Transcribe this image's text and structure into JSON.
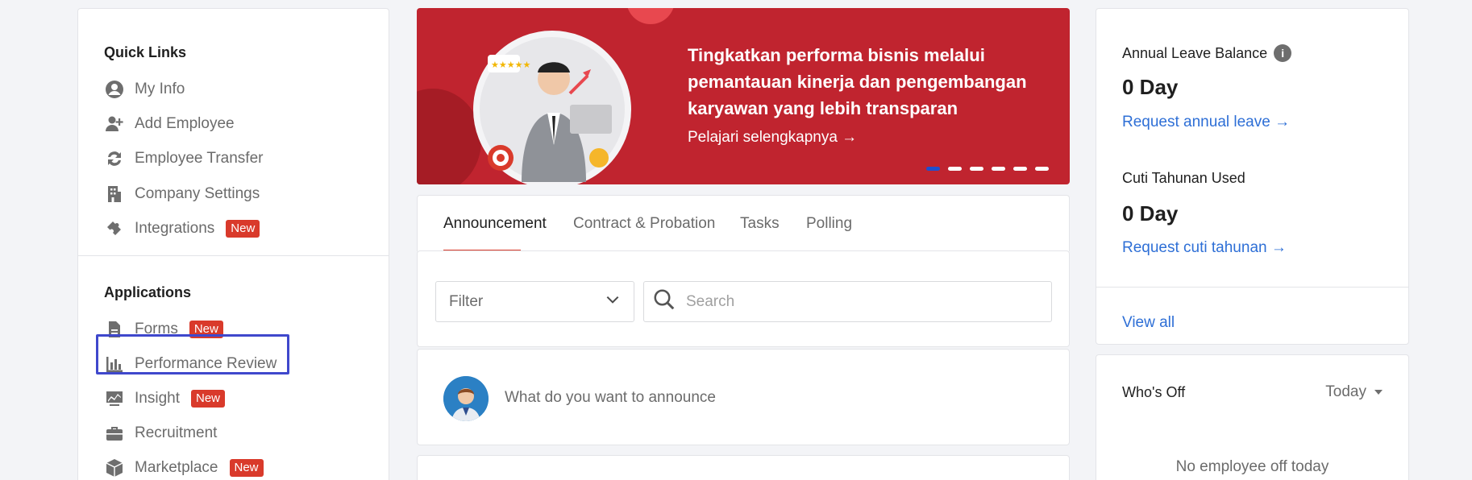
{
  "quick_links": {
    "title": "Quick Links",
    "items": [
      {
        "label": "My Info",
        "icon": "user-circle-icon",
        "badge": ""
      },
      {
        "label": "Add Employee",
        "icon": "user-plus-icon",
        "badge": ""
      },
      {
        "label": "Employee Transfer",
        "icon": "transfer-arrows-icon",
        "badge": ""
      },
      {
        "label": "Company Settings",
        "icon": "building-icon",
        "badge": ""
      },
      {
        "label": "Integrations",
        "icon": "puzzle-icon",
        "badge": "New"
      }
    ]
  },
  "applications": {
    "title": "Applications",
    "items": [
      {
        "label": "Forms",
        "icon": "document-icon",
        "badge": "New"
      },
      {
        "label": "Performance Review",
        "icon": "bar-chart-icon",
        "badge": ""
      },
      {
        "label": "Insight",
        "icon": "insight-chart-icon",
        "badge": "New"
      },
      {
        "label": "Recruitment",
        "icon": "briefcase-icon",
        "badge": ""
      },
      {
        "label": "Marketplace",
        "icon": "cube-icon",
        "badge": "New"
      }
    ]
  },
  "banner": {
    "headline": "Tingkatkan performa bisnis melalui pemantauan kinerja dan pengembangan karyawan yang lebih transparan",
    "cta": "Pelajari selengkapnya →",
    "slides": 6,
    "active_slide": 1
  },
  "tabs": [
    "Announcement",
    "Contract & Probation",
    "Tasks",
    "Polling"
  ],
  "filter": {
    "label": "Filter"
  },
  "search": {
    "placeholder": "Search"
  },
  "announce": {
    "prompt": "What do you want to announce"
  },
  "leave": {
    "annual_title": "Annual Leave Balance",
    "annual_value": "0 Day",
    "annual_link": "Request annual leave →",
    "used_title": "Cuti Tahunan Used",
    "used_value": "0 Day",
    "used_link": "Request cuti tahunan →",
    "view_all": "View all"
  },
  "whos_off": {
    "title": "Who's Off",
    "period": "Today",
    "empty": "No employee off today"
  },
  "colors": {
    "brand_red": "#c0242f",
    "badge_red": "#d93a2b",
    "link_blue": "#2e6fd6",
    "highlight": "#3f48cc"
  }
}
